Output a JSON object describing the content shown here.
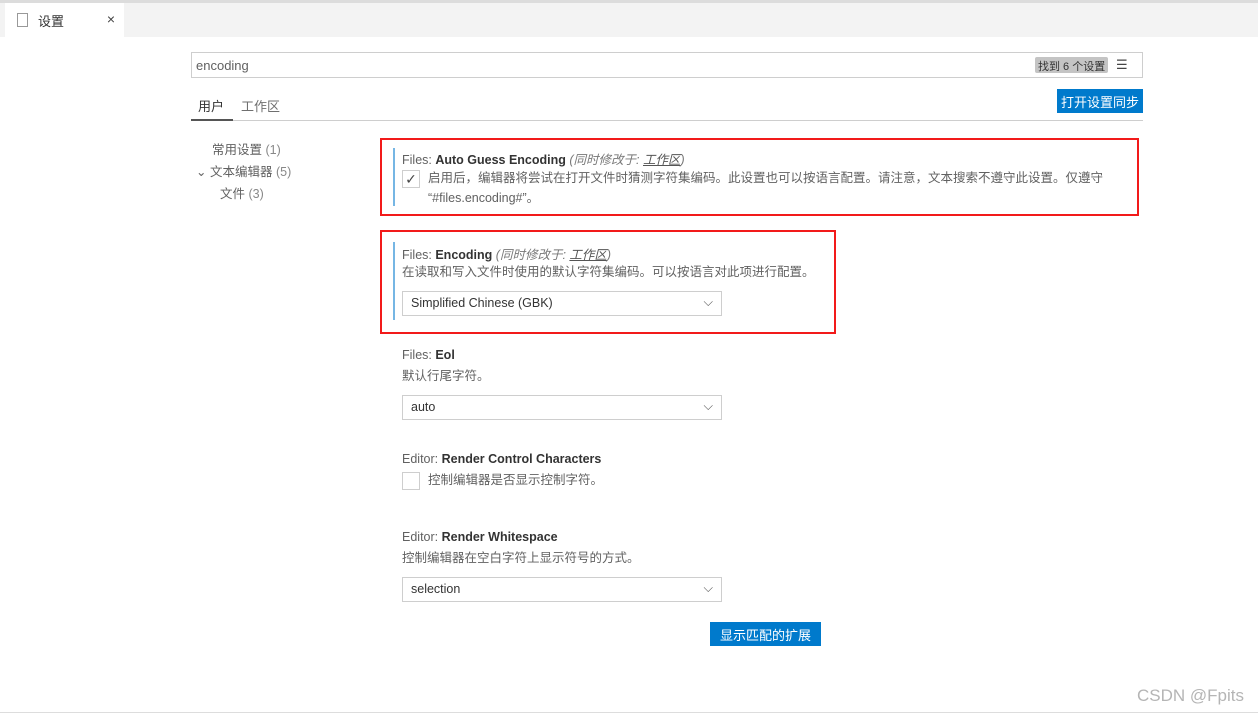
{
  "tab": {
    "title": "设置",
    "close": "×"
  },
  "search": {
    "value": "encoding",
    "count": "找到 6 个设置",
    "clear_icon": "clear-filter-icon"
  },
  "scope_tabs": [
    {
      "label": "用户"
    },
    {
      "label": "工作区"
    }
  ],
  "sync_button": "打开设置同步",
  "tree": [
    {
      "label": "常用设置",
      "count": "(1)"
    },
    {
      "label": "文本编辑器",
      "count": "(5)",
      "chevron": "⌵"
    },
    {
      "label": "文件",
      "count": "(3)"
    }
  ],
  "settings": [
    {
      "category": "Files: ",
      "name": "Auto Guess Encoding",
      "modified": "(同时修改于: ",
      "modified_link": "工作区",
      "modified_end": ")",
      "checked": true,
      "desc": "启用后，编辑器将尝试在打开文件时猜测字符集编码。此设置也可以按语言配置。请注意，文本搜索不遵守此设置。仅遵守 “#files.encoding#”。"
    },
    {
      "category": "Files: ",
      "name": "Encoding",
      "modified": "(同时修改于: ",
      "modified_link": "工作区",
      "modified_end": ")",
      "desc": "在读取和写入文件时使用的默认字符集编码。可以按语言对此项进行配置。",
      "value": "Simplified Chinese (GBK)"
    },
    {
      "category": "Files: ",
      "name": "Eol",
      "desc": "默认行尾字符。",
      "value": "auto"
    },
    {
      "category": "Editor: ",
      "name": "Render Control Characters",
      "checked": false,
      "desc": "控制编辑器是否显示控制字符。"
    },
    {
      "category": "Editor: ",
      "name": "Render Whitespace",
      "desc": "控制编辑器在空白字符上显示符号的方式。",
      "value": "selection"
    }
  ],
  "ext_button": "显示匹配的扩展",
  "watermark": "CSDN @Fpits",
  "colors": {
    "accent": "#007acc",
    "highlight": "#f21a1a",
    "modified_bar": "#76b6e4"
  }
}
